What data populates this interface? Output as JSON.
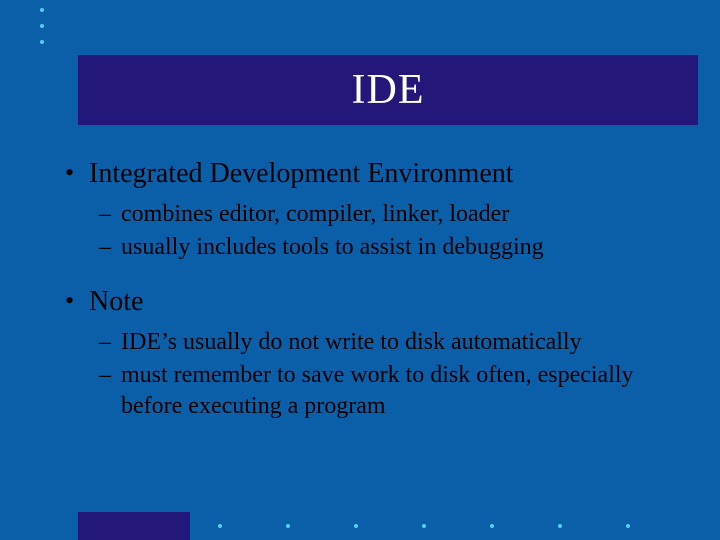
{
  "title": "IDE",
  "bullets": [
    {
      "text": "Integrated Development Environment",
      "children": [
        "combines editor, compiler, linker, loader",
        "usually includes tools to assist in debugging"
      ]
    },
    {
      "text": "Note",
      "children": [
        "IDE’s usually do not write to disk automatically",
        "must remember to save work to disk often, especially before executing a program"
      ]
    }
  ]
}
